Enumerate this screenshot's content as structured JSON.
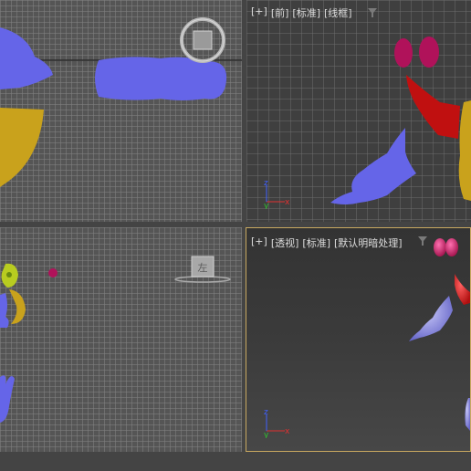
{
  "viewports": {
    "front": {
      "labels": [
        "[+]",
        "[前]",
        "[标准]",
        "[线框]"
      ]
    },
    "perspective": {
      "labels": [
        "[+]",
        "[透视]",
        "[标准]",
        "[默认明暗处理]"
      ]
    }
  },
  "viewcube": {
    "left_face_text": "左"
  },
  "axis": {
    "x": "x",
    "y": "y",
    "z": "z"
  },
  "colors": {
    "viewport_bg": "#555555",
    "grid_line": "#828282",
    "active_border": "#c8a860",
    "blue_object": "#6565e8",
    "yellow_object": "#c9a21c",
    "red_object": "#c01010",
    "magenta_object": "#b0125a",
    "x_axis": "#e03030",
    "y_axis": "#30c030",
    "z_axis": "#4060ff"
  },
  "icons": [
    "filter-icon",
    "viewcube-icon",
    "axis-gizmo-icon"
  ]
}
